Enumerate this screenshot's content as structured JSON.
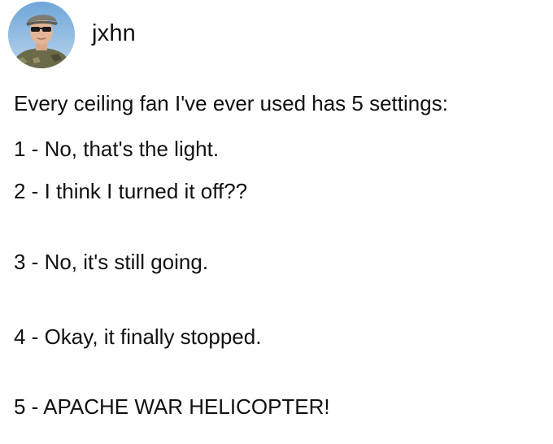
{
  "author": {
    "username": "jxhn",
    "avatar_icon": "profile-photo"
  },
  "post": {
    "intro": "Every ceiling fan I've ever used has 5 settings:",
    "settings": [
      "1 - No, that's the light.",
      "2 - I think I turned it off??",
      "3 - No, it's still going.",
      "4 - Okay, it finally stopped.",
      "5 - APACHE WAR HELICOPTER!"
    ]
  }
}
